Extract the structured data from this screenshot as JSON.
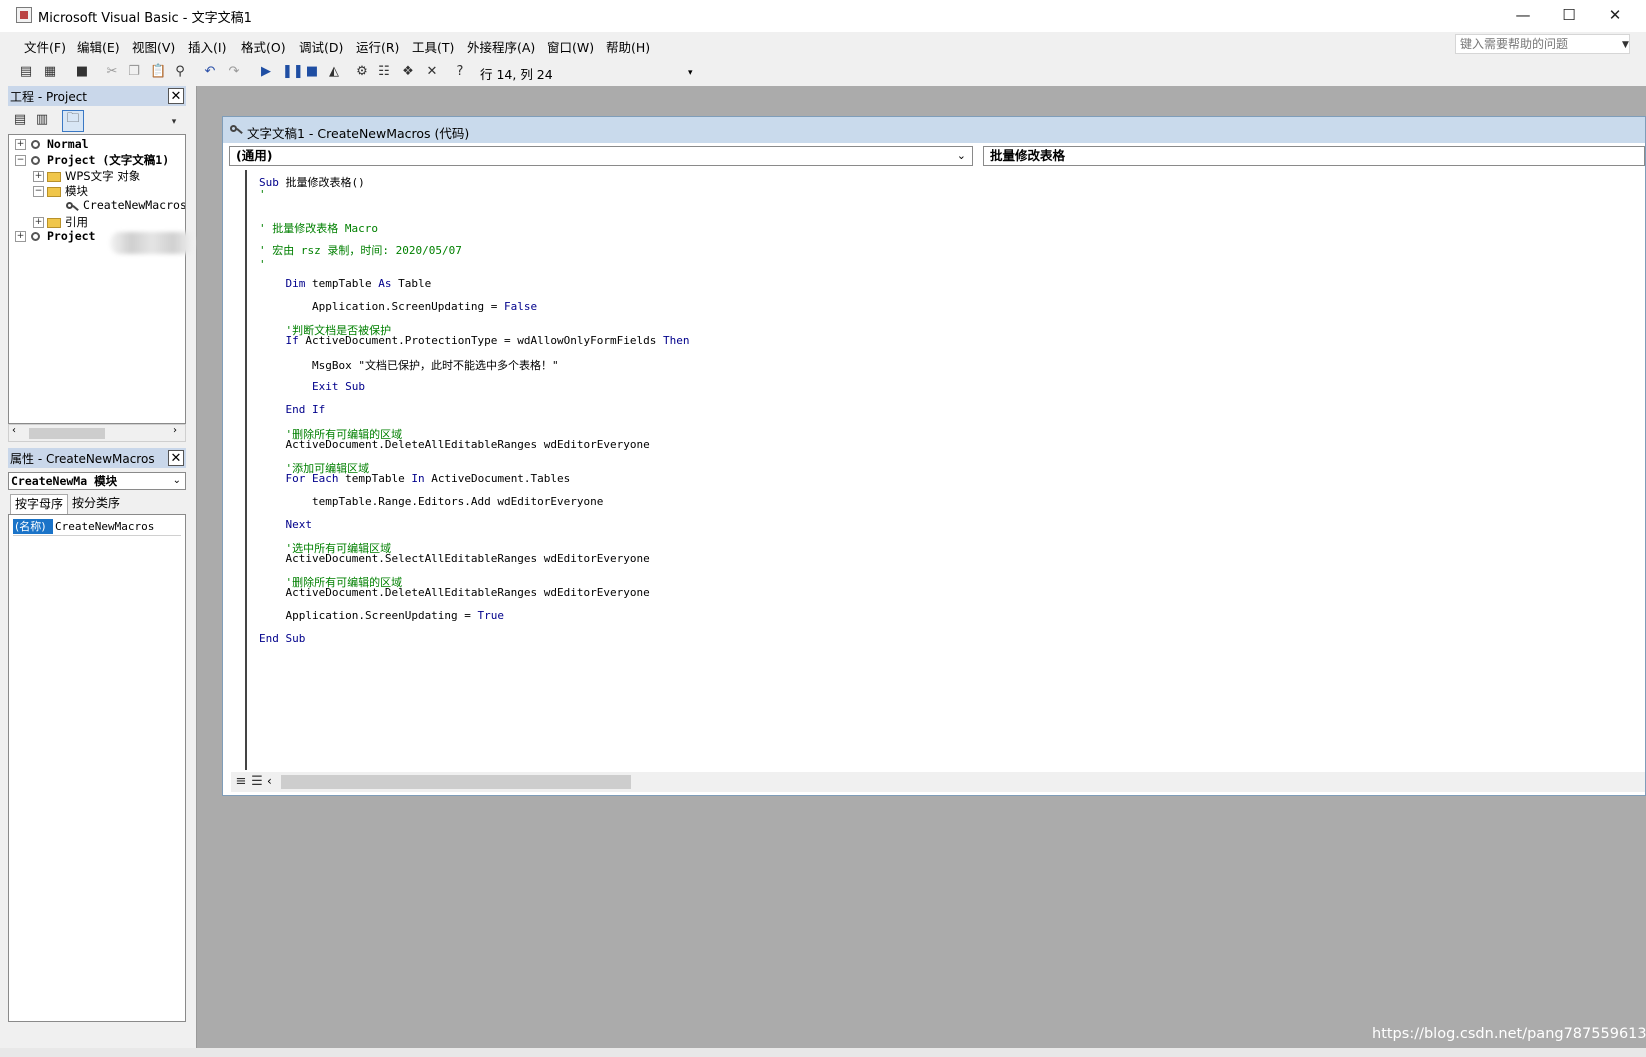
{
  "window": {
    "title": "Microsoft Visual Basic - 文字文稿1",
    "minimize_glyph": "—",
    "maximize_glyph": "☐",
    "close_glyph": "✕"
  },
  "menu": [
    {
      "label": "文件(F)"
    },
    {
      "label": "编辑(E)"
    },
    {
      "label": "视图(V)"
    },
    {
      "label": "插入(I)"
    },
    {
      "label": "格式(O)"
    },
    {
      "label": "调试(D)"
    },
    {
      "label": "运行(R)"
    },
    {
      "label": "工具(T)"
    },
    {
      "label": "外接程序(A)"
    },
    {
      "label": "窗口(W)"
    },
    {
      "label": "帮助(H)"
    }
  ],
  "help_box": {
    "placeholder": "键入需要帮助的问题"
  },
  "toolbar": {
    "cursor_position": "行 14, 列 24",
    "icons": [
      "view-word-icon",
      "insert-module-icon",
      "save-icon",
      "cut-icon",
      "copy-icon",
      "paste-icon",
      "find-icon",
      "undo-icon",
      "redo-icon",
      "run-icon",
      "break-icon",
      "reset-icon",
      "design-mode-icon",
      "project-explorer-icon",
      "properties-icon",
      "object-browser-icon",
      "toolbox-icon",
      "help-icon"
    ]
  },
  "project_panel": {
    "title": "工程 - Project",
    "tree": [
      {
        "label": "Normal",
        "expander": "+"
      },
      {
        "label": "Project (文字文稿1)",
        "expander": "−"
      },
      {
        "label": "WPS文字 对象",
        "expander": "+"
      },
      {
        "label": "模块",
        "expander": "−"
      },
      {
        "label": "CreateNewMacros"
      },
      {
        "label": "引用",
        "expander": "+"
      },
      {
        "label": "Project",
        "expander": "+"
      }
    ]
  },
  "properties_panel": {
    "title": "属性 - CreateNewMacros",
    "object_selector": "CreateNewMa 模块",
    "tabs": [
      "按字母序",
      "按分类序"
    ],
    "rows": [
      {
        "name": "(名称)",
        "value": "CreateNewMacros"
      }
    ]
  },
  "code_window": {
    "title": "文字文稿1 - CreateNewMacros (代码)",
    "object_combo": "(通用)",
    "procedure_combo": "批量修改表格",
    "lines": [
      {
        "tokens": [
          {
            "t": "Sub ",
            "c": "kw"
          },
          {
            "t": "批量修改表格()",
            "c": ""
          }
        ]
      },
      {
        "tokens": [
          {
            "t": "'",
            "c": "cm"
          }
        ]
      },
      {
        "tokens": [
          {
            "t": "' 批量修改表格 Macro",
            "c": "cm"
          }
        ]
      },
      {
        "tokens": [
          {
            "t": "' 宏由 rsz 录制，时间: 2020/05/07",
            "c": "cm"
          }
        ]
      },
      {
        "tokens": [
          {
            "t": "'",
            "c": "cm"
          }
        ]
      },
      {
        "tokens": [
          {
            "t": "    ",
            "c": ""
          },
          {
            "t": "Dim ",
            "c": "kw"
          },
          {
            "t": "tempTable ",
            "c": ""
          },
          {
            "t": "As ",
            "c": "kw"
          },
          {
            "t": "Table",
            "c": ""
          }
        ]
      },
      {
        "tokens": [
          {
            "t": "        Application.ScreenUpdating = ",
            "c": ""
          },
          {
            "t": "False",
            "c": "kw"
          }
        ]
      },
      {
        "tokens": [
          {
            "t": "    '判断文档是否被保护",
            "c": "cm"
          }
        ]
      },
      {
        "tokens": [
          {
            "t": "    ",
            "c": ""
          },
          {
            "t": "If ",
            "c": "kw"
          },
          {
            "t": "ActiveDocument.ProtectionType = wdAllowOnlyFormFields ",
            "c": ""
          },
          {
            "t": "Then",
            "c": "kw"
          }
        ]
      },
      {
        "tokens": [
          {
            "t": "        MsgBox \"文档已保护，此时不能选中多个表格！\"",
            "c": ""
          }
        ]
      },
      {
        "tokens": [
          {
            "t": "        ",
            "c": ""
          },
          {
            "t": "Exit Sub",
            "c": "kw"
          }
        ]
      },
      {
        "tokens": [
          {
            "t": "    ",
            "c": ""
          },
          {
            "t": "End If",
            "c": "kw"
          }
        ]
      },
      {
        "tokens": [
          {
            "t": "    '删除所有可编辑的区域",
            "c": "cm"
          }
        ]
      },
      {
        "tokens": [
          {
            "t": "    ActiveDocument.DeleteAllEditableRanges wdEditorEveryone",
            "c": ""
          }
        ]
      },
      {
        "tokens": [
          {
            "t": "    '添加可编辑区域",
            "c": "cm"
          }
        ]
      },
      {
        "tokens": [
          {
            "t": "    ",
            "c": ""
          },
          {
            "t": "For Each ",
            "c": "kw"
          },
          {
            "t": "tempTable ",
            "c": ""
          },
          {
            "t": "In ",
            "c": "kw"
          },
          {
            "t": "ActiveDocument.Tables",
            "c": ""
          }
        ]
      },
      {
        "tokens": [
          {
            "t": "        tempTable.Range.Editors.Add wdEditorEveryone",
            "c": ""
          }
        ]
      },
      {
        "tokens": [
          {
            "t": "    ",
            "c": ""
          },
          {
            "t": "Next",
            "c": "kw"
          }
        ]
      },
      {
        "tokens": [
          {
            "t": "    '选中所有可编辑区域",
            "c": "cm"
          }
        ]
      },
      {
        "tokens": [
          {
            "t": "    ActiveDocument.SelectAllEditableRanges wdEditorEveryone",
            "c": ""
          }
        ]
      },
      {
        "tokens": [
          {
            "t": "    '删除所有可编辑的区域",
            "c": "cm"
          }
        ]
      },
      {
        "tokens": [
          {
            "t": "    ActiveDocument.DeleteAllEditableRanges wdEditorEveryone",
            "c": ""
          }
        ]
      },
      {
        "tokens": [
          {
            "t": "    Application.ScreenUpdating = ",
            "c": ""
          },
          {
            "t": "True",
            "c": "kw"
          }
        ]
      },
      {
        "tokens": [
          {
            "t": "End Sub",
            "c": "kw"
          }
        ]
      }
    ]
  },
  "watermark": "https://blog.csdn.net/pang787559613",
  "colors": {
    "keyword": "#00008b",
    "comment": "#008000",
    "panel_title": "#c9d7ea",
    "mdi_background": "#ababab"
  }
}
